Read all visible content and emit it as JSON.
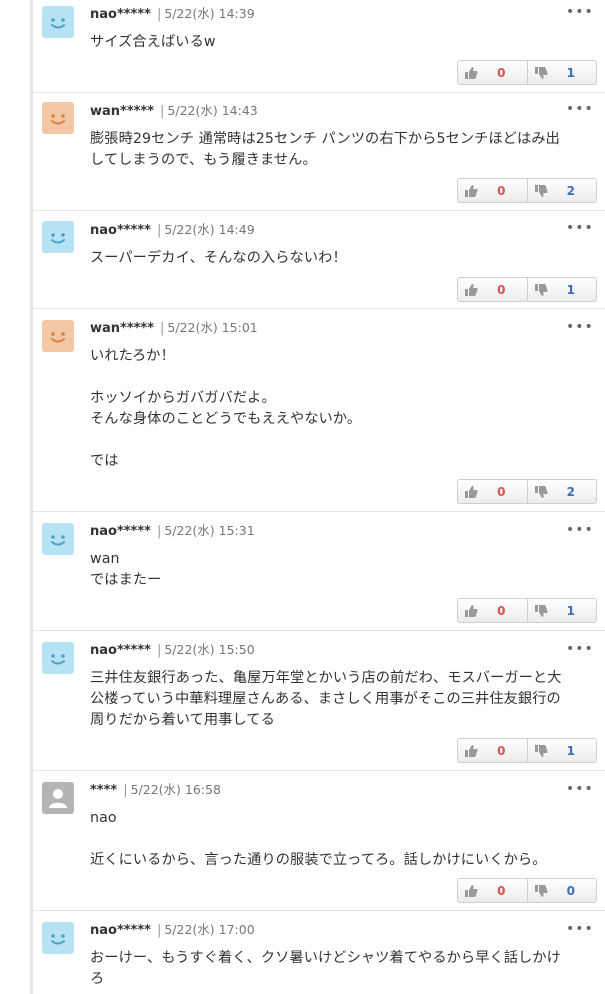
{
  "colors": {
    "agree": "#d9534f",
    "disagree": "#3b6fb6"
  },
  "comments": [
    {
      "avatar": "smile-face-blue",
      "user": "nao*****",
      "date": "5/22(水) 14:39",
      "text": "サイズ合えばいるw",
      "good": "0",
      "bad": "1"
    },
    {
      "avatar": "smile-face-peach",
      "user": "wan*****",
      "date": "5/22(水) 14:43",
      "text": "膨張時29センチ 通常時は25センチ パンツの右下から5センチほどはみ出\nしてしまうので、もう履きません。",
      "good": "0",
      "bad": "2"
    },
    {
      "avatar": "smile-face-blue",
      "user": "nao*****",
      "date": "5/22(水) 14:49",
      "text": "スーパーデカイ、そんなの入らないわ！",
      "good": "0",
      "bad": "1"
    },
    {
      "avatar": "smile-face-peach",
      "user": "wan*****",
      "date": "5/22(水) 15:01",
      "text": "いれたろか！\n\nホッソイからガバガバだよ。\nそんな身体のことどうでもええやないか。\n\nでは",
      "good": "0",
      "bad": "2"
    },
    {
      "avatar": "smile-face-blue",
      "user": "nao*****",
      "date": "5/22(水) 15:31",
      "text": "wan\nではまたー",
      "good": "0",
      "bad": "1"
    },
    {
      "avatar": "smile-face-blue",
      "user": "nao*****",
      "date": "5/22(水) 15:50",
      "text": "三井住友銀行あった、亀屋万年堂とかいう店の前だわ、モスバーガーと大\n公楼っていう中華料理屋さんある、まさしく用事がそこの三井住友銀行の\n周りだから着いて用事してる",
      "good": "0",
      "bad": "1"
    },
    {
      "avatar": "default-user-icon",
      "user": "****",
      "date": "5/22(水) 16:58",
      "text": "nao\n\n近くにいるから、言った通りの服装で立ってろ。話しかけにいくから。",
      "good": "0",
      "bad": "0"
    },
    {
      "avatar": "smile-face-blue",
      "user": "nao*****",
      "date": "5/22(水) 17:00",
      "text": "おーけー、もうすぐ着く、クソ暑いけどシャツ着てやるから早く話しかけ\nろ",
      "good": null,
      "bad": null
    }
  ]
}
